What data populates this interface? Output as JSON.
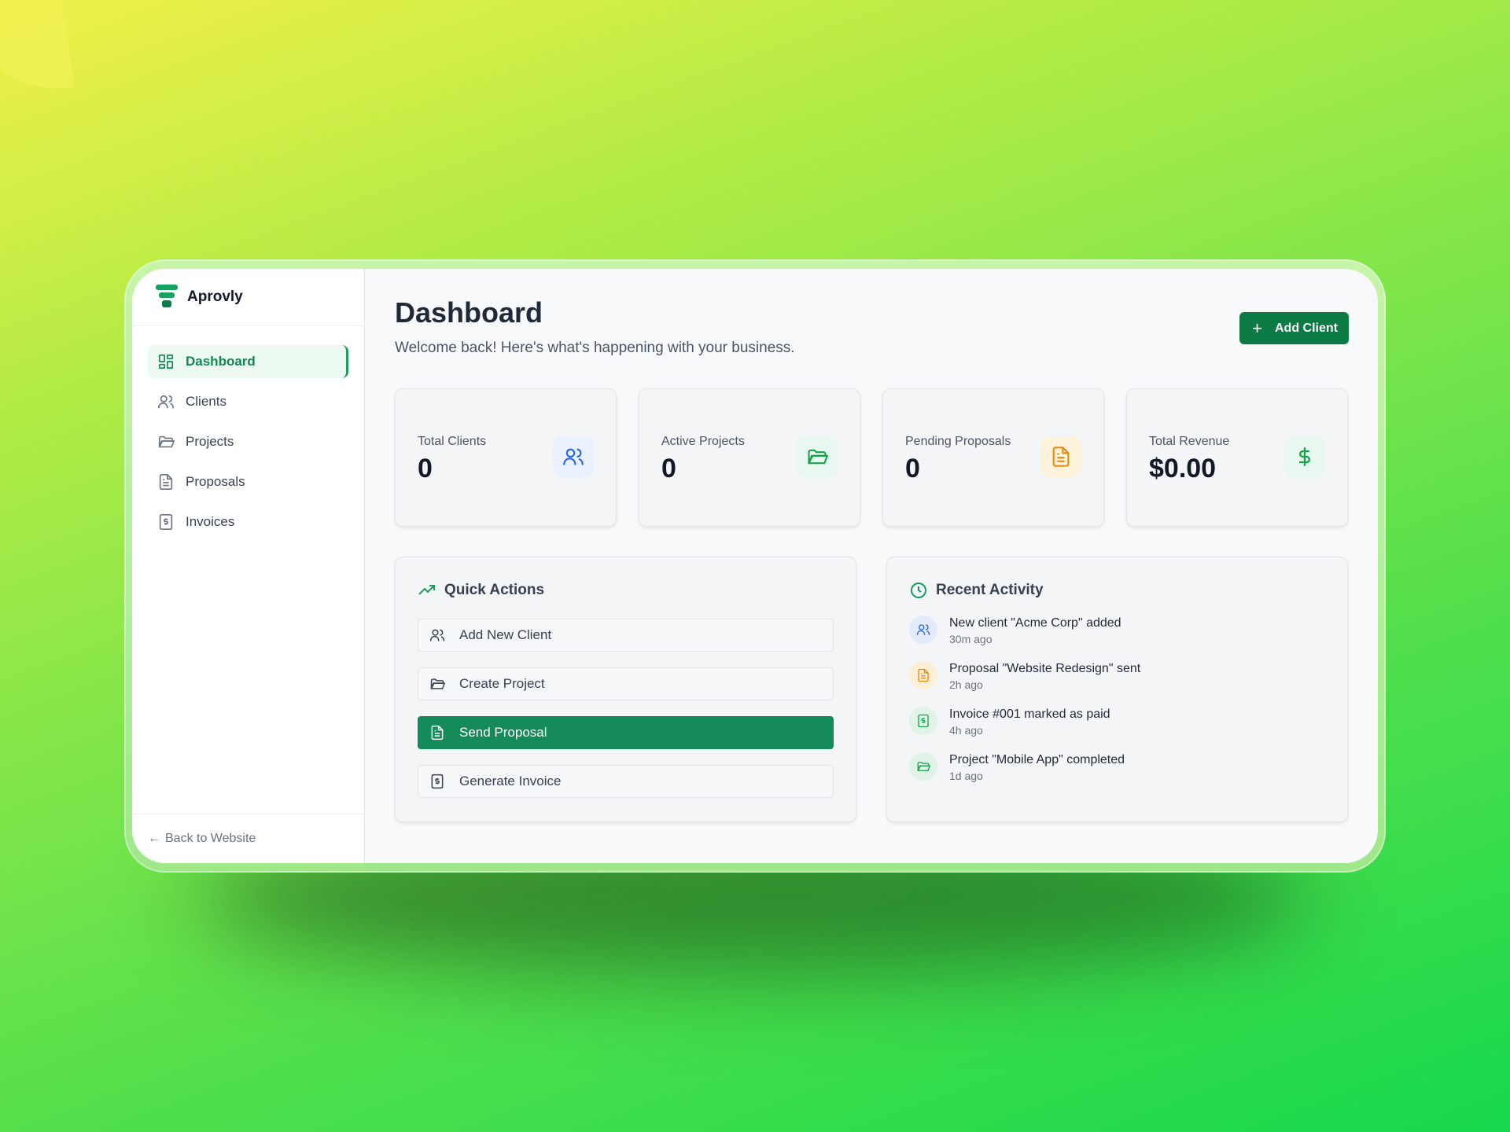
{
  "brand": {
    "name": "Aprovly",
    "color": "#128653"
  },
  "sidebar": {
    "items": [
      {
        "label": "Dashboard",
        "icon": "grid-icon",
        "active": true
      },
      {
        "label": "Clients",
        "icon": "users-icon"
      },
      {
        "label": "Projects",
        "icon": "folder-icon"
      },
      {
        "label": "Proposals",
        "icon": "document-icon"
      },
      {
        "label": "Invoices",
        "icon": "invoice-icon"
      }
    ],
    "back_label": "Back to Website"
  },
  "header": {
    "title": "Dashboard",
    "subtitle": "Welcome back! Here's what's happening with your business.",
    "add_client_label": "Add Client"
  },
  "stats": [
    {
      "label": "Total Clients",
      "value": "0",
      "icon": "users-icon",
      "color": "#2563eb"
    },
    {
      "label": "Active Projects",
      "value": "0",
      "icon": "folder-icon",
      "color": "#16a34a"
    },
    {
      "label": "Pending Proposals",
      "value": "0",
      "icon": "document-icon",
      "color": "#ea8a0c"
    },
    {
      "label": "Total Revenue",
      "value": "$0.00",
      "icon": "dollar-icon",
      "color": "#16a34a"
    }
  ],
  "quick_actions": {
    "title": "Quick Actions",
    "items": [
      {
        "label": "Add New Client",
        "icon": "users-icon"
      },
      {
        "label": "Create Project",
        "icon": "folder-icon"
      },
      {
        "label": "Send Proposal",
        "icon": "document-icon",
        "highlighted": true
      },
      {
        "label": "Generate Invoice",
        "icon": "invoice-icon"
      }
    ]
  },
  "recent_activity": {
    "title": "Recent Activity",
    "items": [
      {
        "text": "New client \"Acme Corp\" added",
        "time": "30m ago",
        "icon": "users-icon"
      },
      {
        "text": "Proposal \"Website Redesign\" sent",
        "time": "2h ago",
        "icon": "document-icon"
      },
      {
        "text": "Invoice #001 marked as paid",
        "time": "4h ago",
        "icon": "invoice-icon"
      },
      {
        "text": "Project \"Mobile App\" completed",
        "time": "1d ago",
        "icon": "folder-icon"
      }
    ]
  }
}
